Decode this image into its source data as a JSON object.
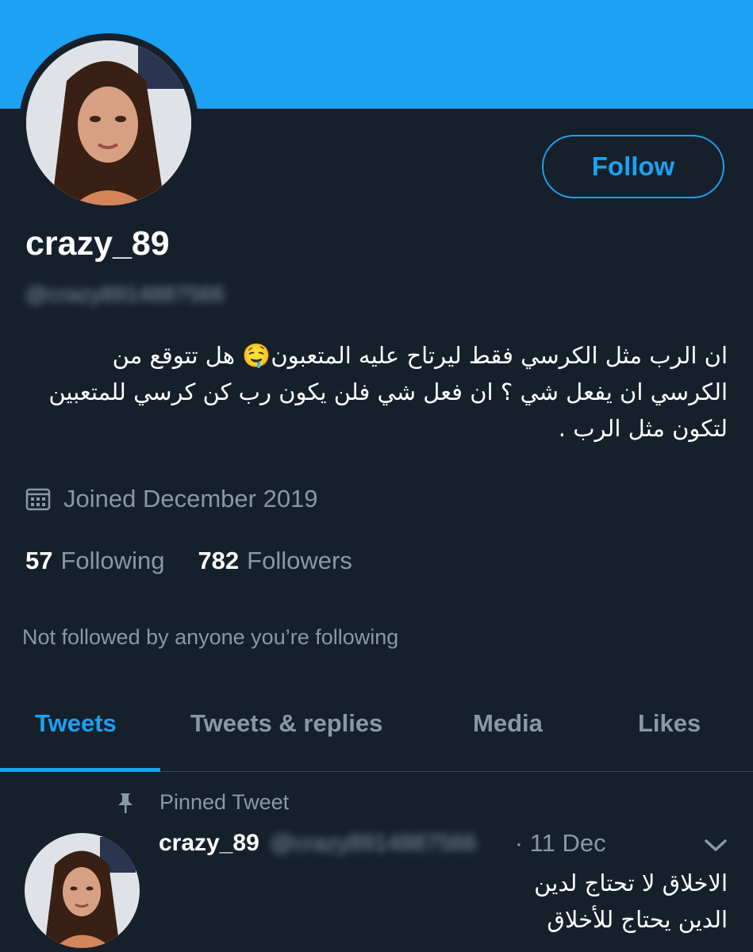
{
  "profile": {
    "display_name": "crazy_89",
    "handle": "@crazy8914887566",
    "follow_label": "Follow",
    "bio": "ان الرب مثل الكرسي فقط ليرتاح عليه المتعبون🤤 هل تتوقع من الكرسي ان يفعل شي ؟ ان فعل شي فلن يكون رب كن كرسي للمتعبين لتكون مثل الرب .",
    "joined": "Joined December 2019",
    "following_count": "57",
    "following_label": "Following",
    "followers_count": "782",
    "followers_label": "Followers",
    "not_followed": "Not followed by anyone you’re following"
  },
  "tabs": [
    {
      "label": "Tweets",
      "active": true
    },
    {
      "label": "Tweets & replies",
      "active": false
    },
    {
      "label": "Media",
      "active": false
    },
    {
      "label": "Likes",
      "active": false
    }
  ],
  "pinned_tweet": {
    "pinned_label": "Pinned Tweet",
    "name": "crazy_89",
    "handle": "@crazy8914887566",
    "date": "· 11 Dec",
    "text_lines": [
      "الاخلاق لا تحتاج لدين",
      "الدين يحتاج للأخلاق"
    ]
  },
  "colors": {
    "accent": "#1da1f2",
    "background": "#15202b",
    "secondary_text": "#8899a6"
  }
}
